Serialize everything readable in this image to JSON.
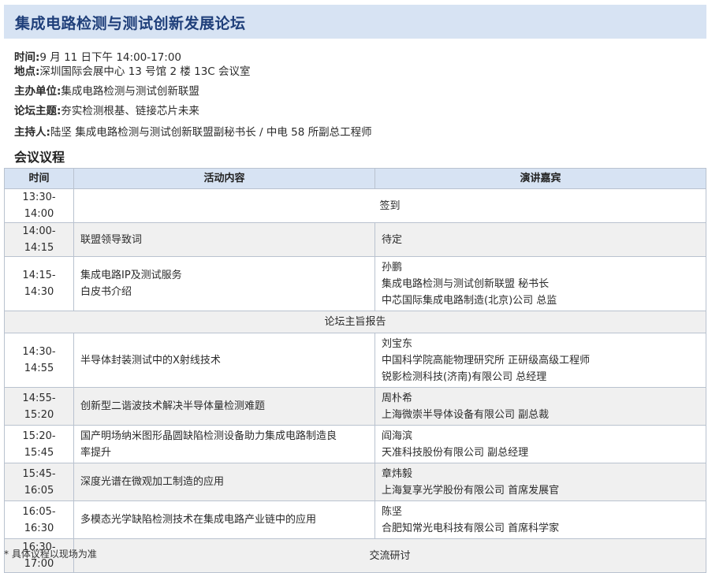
{
  "header": {
    "title": "集成电路检测与测试创新发展论坛"
  },
  "info": {
    "time_label": "时间:",
    "time_value": "9 月 11 日下午 14:00-17:00",
    "place_label": "地点:",
    "place_value": "深圳国际会展中心 13 号馆 2 楼 13C 会议室",
    "organizer_label": "主办单位:",
    "organizer_value": "集成电路检测与测试创新联盟",
    "theme_label": "论坛主题:",
    "theme_value": "夯实检测根基、链接芯片未来",
    "host_label": "主持人:",
    "host_value": "陆坚 集成电路检测与测试创新联盟副秘书长 / 中电 58 所副总工程师"
  },
  "agenda": {
    "title": "会议议程",
    "headers": {
      "time": "时间",
      "content": "活动内容",
      "speaker": "演讲嘉宾"
    },
    "rows": [
      {
        "time": "13:30-14:00",
        "merged": "签到",
        "shaded": false
      },
      {
        "time": "14:00-14:15",
        "content": [
          "联盟领导致词"
        ],
        "speaker": [
          "待定"
        ],
        "shaded": true
      },
      {
        "time": "14:15-14:30",
        "content": [
          "集成电路IP及测试服务",
          "白皮书介绍"
        ],
        "speaker": [
          "孙鹏",
          "集成电路检测与测试创新联盟 秘书长",
          "中芯国际集成电路制造(北京)公司 总监"
        ],
        "shaded": false
      },
      {
        "section": "论坛主旨报告",
        "shaded": true
      },
      {
        "time": "14:30-14:55",
        "content": [
          "半导体封装测试中的X射线技术"
        ],
        "speaker": [
          "刘宝东",
          "中国科学院高能物理研究所 正研级高级工程师",
          "锐影检测科技(济南)有限公司 总经理"
        ],
        "shaded": false
      },
      {
        "time": "14:55-15:20",
        "content": [
          "创新型二谐波技术解决半导体量检测难题"
        ],
        "speaker": [
          "周朴希",
          "上海微崇半导体设备有限公司 副总裁"
        ],
        "shaded": true
      },
      {
        "time": "15:20-15:45",
        "content": [
          "国产明场纳米图形晶圆缺陷检测设备助力集成电路制造良",
          "率提升"
        ],
        "speaker": [
          "阎海滨",
          "天准科技股份有限公司 副总经理"
        ],
        "shaded": false
      },
      {
        "time": "15:45-16:05",
        "content": [
          "深度光谱在微观加工制造的应用"
        ],
        "speaker": [
          "章炜毅",
          "上海复享光学股份有限公司 首席发展官"
        ],
        "shaded": true
      },
      {
        "time": "16:05-16:30",
        "content": [
          "多模态光学缺陷检测技术在集成电路产业链中的应用"
        ],
        "speaker": [
          "陈坚",
          "合肥知常光电科技有限公司 首席科学家"
        ],
        "shaded": false
      },
      {
        "time": "16:30-17:00",
        "merged": "交流研讨",
        "shaded": true
      }
    ]
  },
  "footnote": "* 具体议程以现场为准"
}
